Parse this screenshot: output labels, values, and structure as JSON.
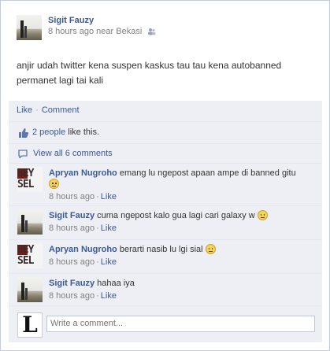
{
  "post": {
    "author": "Sigit Fauzy",
    "time": "8 hours ago",
    "location": "near Bekasi",
    "audience_icon": "people-icon",
    "text": "anjir udah twitter kena suspen kaskus tau tau kena autobanned permanet lagi tai kali"
  },
  "actions": {
    "like_label": "Like",
    "comment_label": "Comment",
    "separator": "·"
  },
  "likes": {
    "count_label": "2 people",
    "suffix": " like this."
  },
  "view_all": {
    "label": "View all 6 comments"
  },
  "comments": [
    {
      "author": "Apryan Nugroho",
      "text": "emang lu ngepost apaan ampe di banned gitu",
      "emoticon": "unamused-face-icon",
      "time": "8 hours ago",
      "like": "Like"
    },
    {
      "author": "Sigit Fauzy",
      "text": "cuma ngepost kalo gua lagi cari galaxy w",
      "emoticon": "unamused-face-icon",
      "time": "8 hours ago",
      "like": "Like"
    },
    {
      "author": "Apryan Nugroho",
      "text": "berarti nasib lu lgi sial",
      "emoticon": "neutral-face-icon",
      "time": "8 hours ago",
      "like": "Like"
    },
    {
      "author": "Sigit Fauzy",
      "text": "hahaa iya",
      "emoticon": "",
      "time": "8 hours ago",
      "like": "Like"
    }
  ],
  "avatar_text": {
    "apryan_top": "BEY",
    "apryan_bottom": "SEL",
    "viewer": "L"
  },
  "write_comment": {
    "placeholder": "Write a comment..."
  },
  "colors": {
    "link": "#3b5998",
    "feedback_bg": "#edeff4",
    "border": "#c4cde0"
  }
}
